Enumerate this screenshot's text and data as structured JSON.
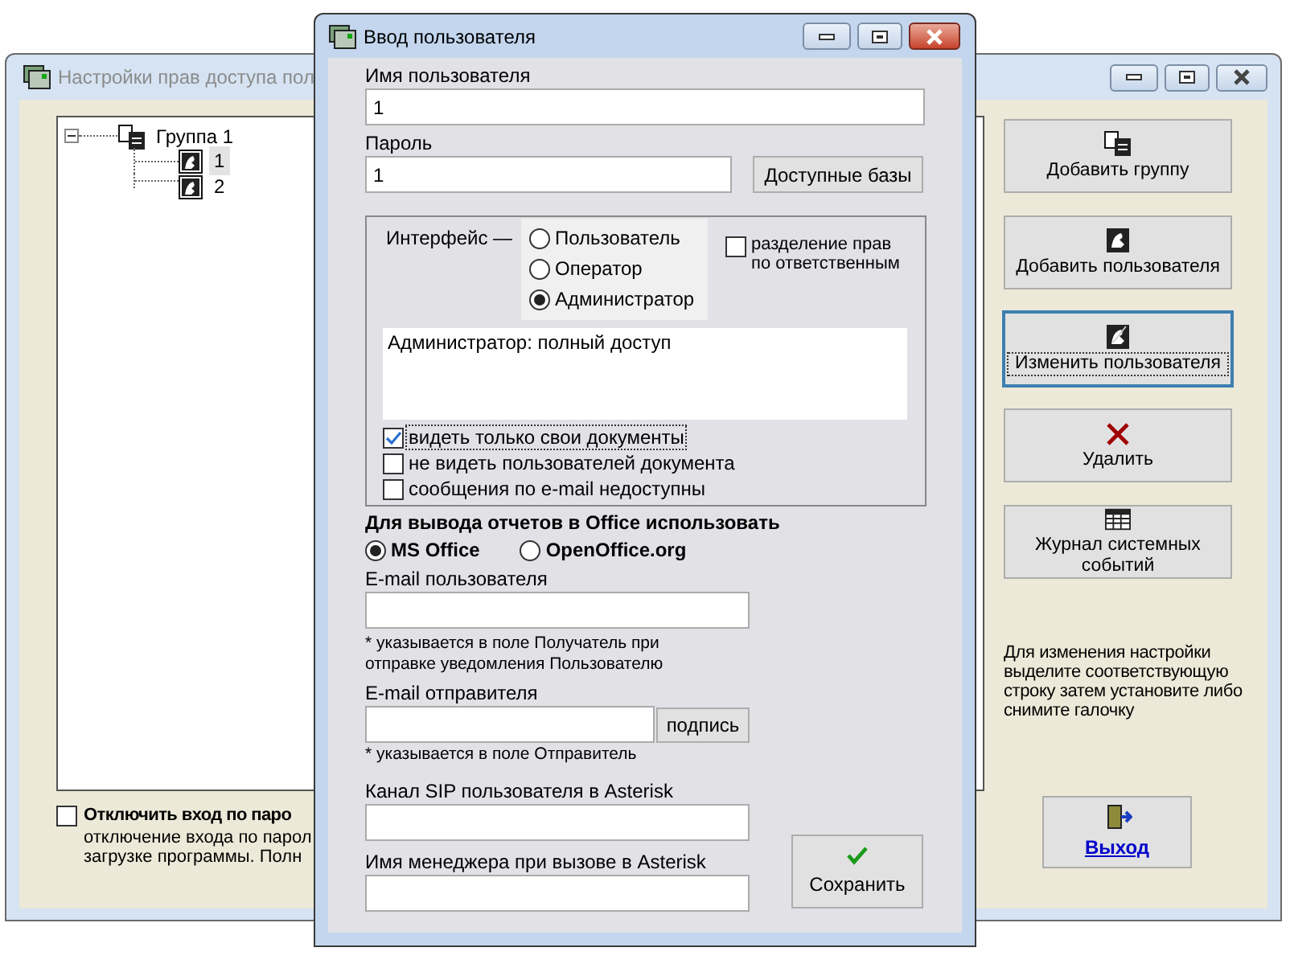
{
  "background_window": {
    "title": "Настройки прав доступа пол",
    "tree": [
      {
        "label": "Группа 1",
        "expanded": true,
        "children": [
          {
            "label": "1",
            "selected": true
          },
          {
            "label": "2",
            "selected": false
          }
        ]
      }
    ],
    "disable_password": {
      "checked": false,
      "label": "Отключить вход по паро",
      "description": [
        "отключение входа по парол",
        "загрузке программы. Полн"
      ]
    },
    "buttons": [
      {
        "kind": "add-group",
        "label": "Добавить группу",
        "focused": false
      },
      {
        "kind": "add-user",
        "label": "Добавить пользователя",
        "focused": false
      },
      {
        "kind": "edit-user",
        "label": "Изменить пользователя",
        "focused": true
      },
      {
        "kind": "delete",
        "label": "Удалить",
        "focused": false
      },
      {
        "kind": "log",
        "label": "Журнал системных событий",
        "focused": false
      }
    ],
    "hint": "Для изменения настройки выделите соответствующую строку затем установите либо снимите галочку",
    "exit_button": "Выход"
  },
  "dialog": {
    "title": "Ввод пользователя",
    "user_name": {
      "label": "Имя пользователя",
      "value": "1"
    },
    "password": {
      "label": "Пароль",
      "value": "1"
    },
    "databases_button": "Доступные базы",
    "interface": {
      "label": "Интерфейс —",
      "options": [
        {
          "label": "Пользователь",
          "selected": false
        },
        {
          "label": "Оператор",
          "selected": false
        },
        {
          "label": "Администратор",
          "selected": true
        }
      ],
      "description": "Администратор: полный доступ"
    },
    "split_rights": {
      "label": "разделение прав по ответственным",
      "checked": false
    },
    "checkboxes": [
      {
        "label": "видеть только свои документы",
        "checked": true,
        "focused": true
      },
      {
        "label": "не видеть пользователей документа",
        "checked": false,
        "focused": false
      },
      {
        "label": "сообщения по e-mail недоступны",
        "checked": false,
        "focused": false
      }
    ],
    "office": {
      "label": "Для вывода отчетов в Office использовать",
      "options": [
        {
          "label": "MS Office",
          "selected": true
        },
        {
          "label": "OpenOffice.org",
          "selected": false
        }
      ]
    },
    "email_user": {
      "label": "E-mail пользователя",
      "note": "* указывается в поле Получатель при отправке уведомления Пользователю"
    },
    "email_sender": {
      "label": "E-mail отправителя",
      "button": "подпись",
      "note": "* указывается в поле Отправитель"
    },
    "sip_channel": {
      "label": "Канал SIP пользователя в Asterisk"
    },
    "manager_name": {
      "label": "Имя менеджера при вызове в Asterisk"
    },
    "save_button": "Сохранить"
  }
}
